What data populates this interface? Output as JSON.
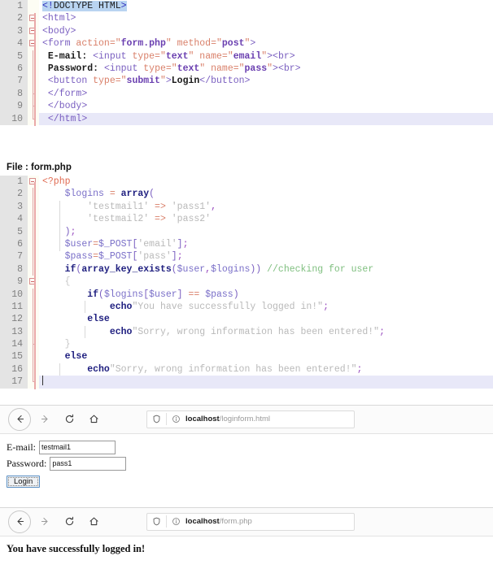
{
  "html_editor": {
    "language": "html",
    "current_line": 10,
    "selected_text": "<!DOCTYPE HTML>",
    "lines": [
      {
        "n": "1",
        "text": "<!DOCTYPE HTML>"
      },
      {
        "n": "2",
        "text": "<html>"
      },
      {
        "n": "3",
        "text": "<body>"
      },
      {
        "n": "4",
        "text": "<form action=\"form.php\" method=\"post\">"
      },
      {
        "n": "5",
        "text": " E-mail: <input type=\"text\" name=\"email\"><br>"
      },
      {
        "n": "6",
        "text": " Password: <input type=\"text\" name=\"pass\"><br>"
      },
      {
        "n": "7",
        "text": " <button type=\"submit\">Login</button>"
      },
      {
        "n": "8",
        "text": " </form>"
      },
      {
        "n": "9",
        "text": " </body>"
      },
      {
        "n": "10",
        "text": " </html>"
      }
    ]
  },
  "php_section": {
    "file_label": "File : form.php",
    "language": "php",
    "current_line": 17,
    "lines": [
      {
        "n": "1",
        "text": "<?php"
      },
      {
        "n": "2",
        "text": "    $logins = array("
      },
      {
        "n": "3",
        "text": "        'testmail1' => 'pass1',"
      },
      {
        "n": "4",
        "text": "        'testmail2' => 'pass2'"
      },
      {
        "n": "5",
        "text": "    );"
      },
      {
        "n": "6",
        "text": "    $user=$_POST['email'];"
      },
      {
        "n": "7",
        "text": "    $pass=$_POST['pass'];"
      },
      {
        "n": "8",
        "text": "    if(array_key_exists($user,$logins)) //checking for user"
      },
      {
        "n": "9",
        "text": "    {"
      },
      {
        "n": "10",
        "text": "        if($logins[$user] == $pass)"
      },
      {
        "n": "11",
        "text": "            echo\"You have successfully logged in!\";"
      },
      {
        "n": "12",
        "text": "        else"
      },
      {
        "n": "13",
        "text": "            echo\"Sorry, wrong information has been entered!\";"
      },
      {
        "n": "14",
        "text": "    }"
      },
      {
        "n": "15",
        "text": "    else"
      },
      {
        "n": "16",
        "text": "        echo\"Sorry, wrong information has been entered!\";"
      },
      {
        "n": "17",
        "text": ""
      }
    ]
  },
  "browser_login": {
    "nav": {
      "back": "back-arrow",
      "forward": "forward-arrow",
      "reload": "reload-arrow",
      "home": "home-house"
    },
    "url": {
      "shield_icon": "shield",
      "info_icon": "info-circle",
      "host": "localhost",
      "path": "/loginform.html"
    },
    "form": {
      "email_label": "E-mail:",
      "email_value": "testmail1",
      "email_placeholder": "",
      "password_label": "Password:",
      "password_value": "pass1",
      "password_placeholder": "",
      "submit_label": "Login"
    }
  },
  "browser_result": {
    "nav": {
      "back": "back-arrow",
      "forward": "forward-arrow",
      "reload": "reload-arrow",
      "home": "home-house"
    },
    "url": {
      "shield_icon": "shield",
      "info_icon": "info-circle",
      "host": "localhost",
      "path": "/form.php"
    },
    "message": "You have successfully logged in!"
  },
  "colors": {
    "gutter_bg": "#e4e4e4",
    "fold_bg": "#fdfdf4",
    "current_line": "#e8e8f8",
    "selection": "#b9d4f1",
    "tag": "#7a5fc0",
    "attr": "#d9806a",
    "value": "#6a3fb0",
    "keyword": "#202080",
    "string": "#b9b9b9",
    "comment": "#7fbf7f",
    "php_open": "#e06b52",
    "variable": "#7a6fc8",
    "fold_marker": "#d88c8c"
  }
}
